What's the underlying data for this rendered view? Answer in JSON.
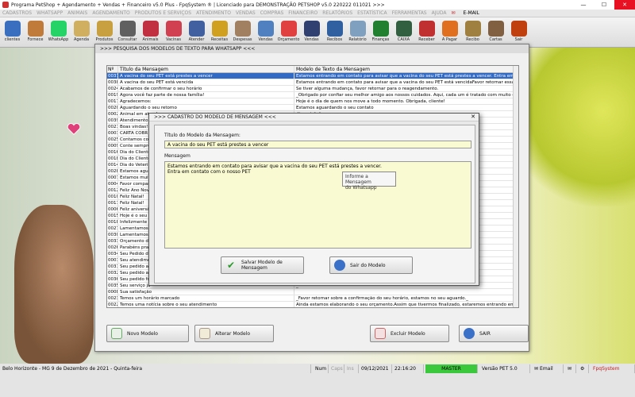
{
  "titlebar": {
    "text": "Programa PetShop + Agendamento + Vendas + Financeiro v5.0 Plus - FpqSystem ® | Licenciado para  DEMONSTRAÇÃO PETSHOP v5.0 220222 011021 >>>"
  },
  "menu": [
    "CADASTROS",
    "WHATSAPP",
    "ANIMAIS",
    "AGENDAMENTO",
    "PRODUTOS E SERVIÇOS",
    "ATENDIMENTO",
    "VENDAS",
    "COMPRAS",
    "FINANCEIRO",
    "RELATÓRIOS",
    "ESTATÍSTICA",
    "FERRAMENTAS",
    "AJUDA"
  ],
  "menu_email": "E-MAIL",
  "toolbar": [
    {
      "label": "clientes",
      "color": "#3a6fc0"
    },
    {
      "label": "Fornece",
      "color": "#c07a3a"
    },
    {
      "label": "WhatsApp",
      "color": "#25d366"
    },
    {
      "label": "Agenda",
      "color": "#d0b060"
    },
    {
      "label": "Produtos",
      "color": "#c8a040"
    },
    {
      "label": "Consultar",
      "color": "#606060"
    },
    {
      "label": "Animais",
      "color": "#c03040"
    },
    {
      "label": "Vacinas",
      "color": "#d04050"
    },
    {
      "label": "Atender",
      "color": "#4060a0"
    },
    {
      "label": "Receitas",
      "color": "#d0a020"
    },
    {
      "label": "Despesas",
      "color": "#a08060"
    },
    {
      "label": "Vendas",
      "color": "#5080c0"
    },
    {
      "label": "Orçamento",
      "color": "#e04040"
    },
    {
      "label": "Vendas",
      "color": "#304070"
    },
    {
      "label": "Recibos",
      "color": "#3060a0"
    },
    {
      "label": "Relatório",
      "color": "#80a0c0"
    },
    {
      "label": "Finanças",
      "color": "#208030"
    },
    {
      "label": "CAIXA",
      "color": "#306040"
    },
    {
      "label": "Receber",
      "color": "#c03030"
    },
    {
      "label": "A Pagar",
      "color": "#e07020"
    },
    {
      "label": "Recibo",
      "color": "#a08040"
    },
    {
      "label": "Cartas",
      "color": "#806040"
    },
    {
      "label": "Sair",
      "color": "#c04010"
    }
  ],
  "main_window": {
    "title": ">>> PESQUISA DOS MODELOS DE TEXTO PARA WHATSAPP <<<",
    "columns": [
      "Nº",
      "Título da Mensagem",
      "Modelo de Texto da Mensagem"
    ],
    "rows": [
      [
        "0037",
        "A vacina do seu PET está prestes a vencer",
        "Estamos entrando em contato para avisar que a vacina do seu PET está prestes a vencer. Entra em contato"
      ],
      [
        "0038",
        "A vacina do seu PET está vencida",
        "Estamos entrando em contato para avisar que a vacina do seu PET está vencidaFavor retornar essa mensag"
      ],
      [
        "0024",
        "Acabamos de confirmar o seu horário",
        "Se tiver alguma mudança, favor retornar para o reagendamento."
      ],
      [
        "0019",
        "Agora você faz parte de nossa família!",
        "_Obrigado por confiar seu melhor amigo aos nossos cuidados. Aqui, cada um é tratado com muito carinho p"
      ],
      [
        "0017",
        "Agradecemos:",
        "Hoje é o dia de quem nos move a todo momento. Obrigada, cliente!"
      ],
      [
        "0020",
        "Aguardando o seu retorno",
        "Estamos aguardando o seu contato"
      ],
      [
        "0002",
        "Animal em atend",
        "disposição!"
      ],
      [
        "0039",
        "Atendimento de",
        "ssa mensag"
      ],
      [
        "0021",
        "Boas vindas!",
        "mos serviços cae"
      ],
      [
        "0003",
        "CARTA COBR",
        "a nossa primeira c"
      ],
      [
        "0025",
        "Contamos com",
        "_"
      ],
      [
        "0009",
        "Conte sempre c",
        "o seu feedbac"
      ],
      [
        "0016",
        "Dia do Cliente",
        "da nossa existê"
      ],
      [
        "0018",
        "Dia do Cliente",
        "e setembro, Dia d"
      ],
      [
        "0014",
        "Dia do Veterinário",
        "os"
      ],
      [
        "0028",
        "Estamos aguar",
        "e o seu retorno"
      ],
      [
        "0007",
        "Estamos muito",
        ""
      ],
      [
        "0004",
        "Favor comparec",
        ""
      ],
      [
        "0012",
        "Feliz Ano Novo",
        "e, confiou nos no"
      ],
      [
        "0010",
        "Feliz Natal!",
        "partilhar instantes con"
      ],
      [
        "0011",
        "Feliz Natal!",
        "Natalinos. Desejamo"
      ],
      [
        "0006",
        "Feliz aniversár",
        "pos que venham se ju"
      ],
      [
        "0015",
        "Hoje é o seu d",
        "eja lembrado com"
      ],
      [
        "0018",
        "Infelizmente ai",
        "e nossos serviço"
      ],
      [
        "0027",
        "Lamentamos",
        ""
      ],
      [
        "0030",
        "Lamentamos a",
        ""
      ],
      [
        "0033",
        "Orçamento do",
        ""
      ],
      [
        "0026",
        "Parabéns pra v",
        "a sua família"
      ],
      [
        "0034",
        "Seu Pedido de",
        ""
      ],
      [
        "0001",
        "Seu atendimen",
        ""
      ],
      [
        "0031",
        "Seu pedido a",
        ""
      ],
      [
        "0032",
        "Seu pedido an",
        ""
      ],
      [
        "0036",
        "Seu pedido fo",
        ""
      ],
      [
        "0035",
        "Seu serviço já",
        "_"
      ],
      [
        "0008",
        "Sua satisfação",
        ""
      ],
      [
        "0023",
        "Temos um horário marcado",
        "_Favor retornar sobre a confirmação do seu horário, estamos no seu aguardo._"
      ],
      [
        "0022",
        "Temos uma notícia sobre o seu atendimento",
        "Ainda estamos elaborando o seu orçamento.Assim que tivermos finalizado, estaremos entrando em contato."
      ],
      [
        "0026",
        "Tivemos um problema com a nossa agenda.",
        "Podemos remarcar o seu horário?Aguardamos o seu retorno"
      ]
    ],
    "buttons": {
      "new": "Novo Modelo",
      "edit": "Alterar Modelo",
      "delete": "Excluir Modelo",
      "exit": "SAIR"
    }
  },
  "dialog": {
    "title": ">>> CADASTRO DO MODELO DE MENSAGEM <<<",
    "title_label": "Título do Modelo da Mensagem:",
    "title_value": "A vacina do seu PET está prestes a vencer",
    "message_label": "Mensagem",
    "message_line1": "Estamos entrando em contato para avisar que a vacina do seu PET está prestes a vencer.",
    "message_line2": "Entra em contato com o nosso PET",
    "tooltip_line1": "Informe a Mensagem",
    "tooltip_line2": "do Whatsapp",
    "save_label": "Salvar Modelo de Mensagem",
    "exit_label": "Sair do Modelo"
  },
  "status": {
    "location": "Belo Horizonte - MG  9 de Dezembro de 2021 - Quinta-feira",
    "num": "Num",
    "caps": "Caps",
    "ins": "Ins",
    "date": "09/12/2021",
    "time": "22:16:20",
    "master": "MASTER",
    "version": "Versão PET 5.0",
    "email": "Email",
    "brand": "FpqSystem"
  }
}
